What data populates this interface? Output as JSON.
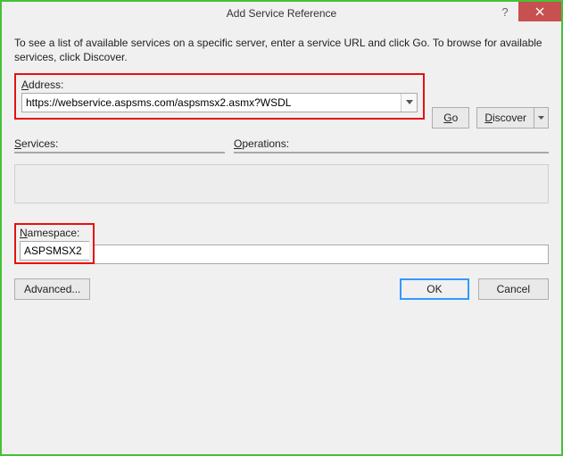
{
  "window": {
    "title": "Add Service Reference"
  },
  "intro": "To see a list of available services on a specific server, enter a service URL and click Go. To browse for available services, click Discover.",
  "address": {
    "label_pre": "A",
    "label_rest": "ddress:",
    "value": "https://webservice.aspsms.com/aspsmsx2.asmx?WSDL"
  },
  "buttons": {
    "go": "Go",
    "discover": "Discover",
    "advanced": "Advanced...",
    "ok": "OK",
    "cancel": "Cancel"
  },
  "services": {
    "label_pre": "S",
    "label_rest": "ervices:"
  },
  "operations": {
    "label_pre": "O",
    "label_rest": "perations:"
  },
  "namespace": {
    "label_pre": "N",
    "label_rest": "amespace:",
    "value": "ASPSMSX2"
  }
}
